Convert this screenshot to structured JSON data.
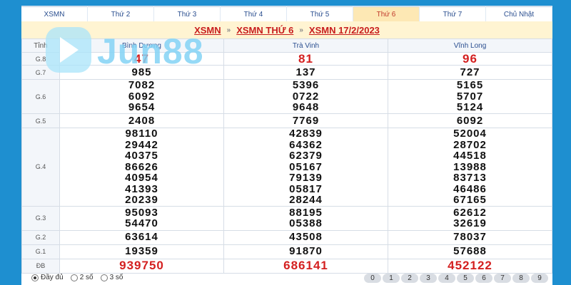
{
  "tabs": [
    "XSMN",
    "Thứ 2",
    "Thứ 3",
    "Thứ 4",
    "Thứ 5",
    "Thứ 6",
    "Thứ 7",
    "Chủ Nhật"
  ],
  "active_tab": "Thứ 6",
  "breadcrumb": [
    "XSMN",
    "XSMN THỨ 6",
    "XSMN 17/2/2023"
  ],
  "breadcrumb_sep": "»",
  "table": {
    "header": "Tỉnh",
    "provinces": [
      "Bình Dương",
      "Trà Vinh",
      "Vĩnh Long"
    ],
    "rows": [
      {
        "prize": "G.8",
        "values": [
          [
            "47"
          ],
          [
            "81"
          ],
          [
            "96"
          ]
        ]
      },
      {
        "prize": "G.7",
        "values": [
          [
            "985"
          ],
          [
            "137"
          ],
          [
            "727"
          ]
        ]
      },
      {
        "prize": "G.6",
        "values": [
          [
            "7082",
            "6092",
            "9654"
          ],
          [
            "5396",
            "0722",
            "9648"
          ],
          [
            "5165",
            "5707",
            "5124"
          ]
        ]
      },
      {
        "prize": "G.5",
        "values": [
          [
            "2408"
          ],
          [
            "7769"
          ],
          [
            "6092"
          ]
        ]
      },
      {
        "prize": "G.4",
        "values": [
          [
            "98110",
            "29442",
            "40375",
            "86626",
            "40954",
            "41393",
            "20239"
          ],
          [
            "42839",
            "64362",
            "62379",
            "05167",
            "79139",
            "05817",
            "28244"
          ],
          [
            "52004",
            "28702",
            "44518",
            "13988",
            "83713",
            "46486",
            "67165"
          ]
        ]
      },
      {
        "prize": "G.3",
        "values": [
          [
            "95093",
            "54470"
          ],
          [
            "88195",
            "05388"
          ],
          [
            "62612",
            "32619"
          ]
        ]
      },
      {
        "prize": "G.2",
        "values": [
          [
            "63614"
          ],
          [
            "43508"
          ],
          [
            "78037"
          ]
        ]
      },
      {
        "prize": "G.1",
        "values": [
          [
            "19359"
          ],
          [
            "91870"
          ],
          [
            "57688"
          ]
        ]
      },
      {
        "prize": "ĐB",
        "values": [
          [
            "939750"
          ],
          [
            "686141"
          ],
          [
            "452122"
          ]
        ]
      }
    ]
  },
  "options": [
    "Đầy đủ",
    "2 số",
    "3 số"
  ],
  "selected_option": "Đầy đủ",
  "digits": [
    "0",
    "1",
    "2",
    "3",
    "4",
    "5",
    "6",
    "7",
    "8",
    "9"
  ],
  "logo_text": "Jun88",
  "colors": {
    "background": "#1e8fd0",
    "highlight": "#d42020",
    "active_tab": "#fde8b4"
  }
}
